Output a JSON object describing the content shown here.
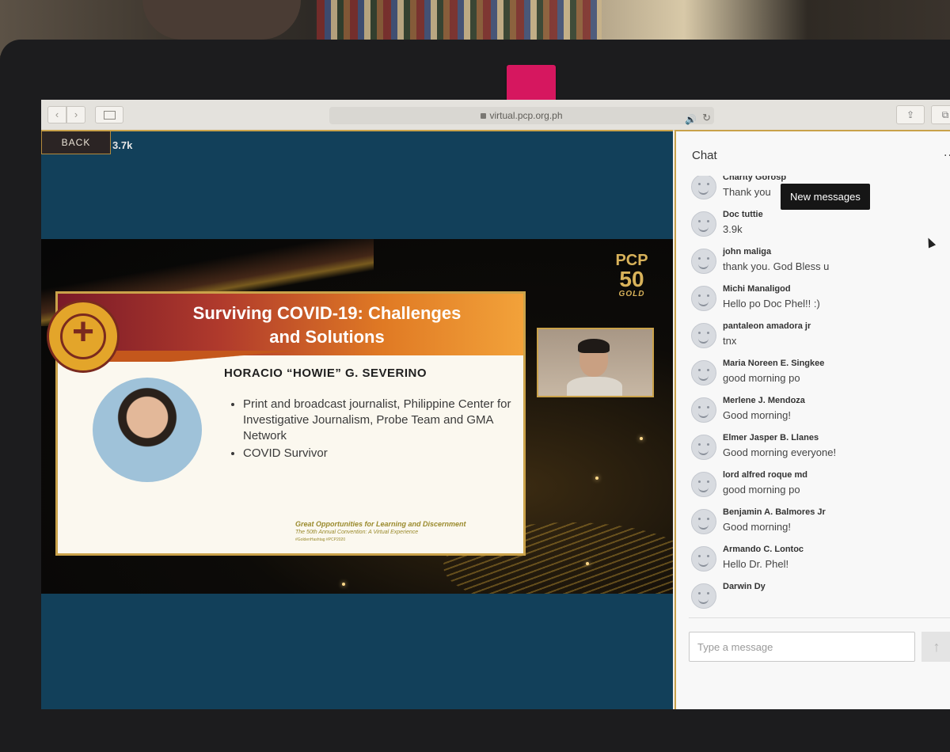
{
  "browser": {
    "url": "virtual.pcp.org.ph",
    "back_glyph": "‹",
    "forward_glyph": "›",
    "volume_glyph": "🔊",
    "reload_glyph": "↻",
    "share_glyph": "⇪",
    "tabs_glyph": "⧉"
  },
  "stage": {
    "back_label": "BACK",
    "viewer_count": "3.7k"
  },
  "slide": {
    "title": "Surviving COVID-19: Challenges and Solutions",
    "speaker_name": "HORACIO “HOWIE” G. SEVERINO",
    "bullets": [
      "Print and broadcast journalist, Philippine Center for Investigative Journalism, Probe Team and GMA Network",
      "COVID Survivor"
    ],
    "footer_line1": "Great Opportunities for Learning and Discernment",
    "footer_line2": "The 50th Annual Convention: A Virtual Experience",
    "footer_line3": "#GoldenHashtag #PCP2020"
  },
  "logo": {
    "line1": "PCP",
    "line2": "50",
    "line3": "GOLD"
  },
  "chat": {
    "title": "Chat",
    "more_glyph": "...",
    "new_messages_label": "New messages",
    "input_placeholder": "Type a message",
    "send_glyph": "↑",
    "messages": [
      {
        "name": "Charity Gorosp",
        "text": "Thank you"
      },
      {
        "name": "Doc tuttie",
        "text": "3.9k"
      },
      {
        "name": "john maliga",
        "text": "thank you. God Bless u"
      },
      {
        "name": "Michi Manaligod",
        "text": "Hello po Doc Phel!! :)"
      },
      {
        "name": "pantaleon amadora jr",
        "text": "tnx"
      },
      {
        "name": "Maria Noreen E. Singkee",
        "text": "good morning po"
      },
      {
        "name": "Merlene J. Mendoza",
        "text": "Good morning!"
      },
      {
        "name": "Elmer Jasper B. Llanes",
        "text": "Good morning everyone!"
      },
      {
        "name": "lord alfred roque md",
        "text": "good morning po"
      },
      {
        "name": "Benjamin A. Balmores Jr",
        "text": "Good morning!"
      },
      {
        "name": "Armando C. Lontoc",
        "text": "Hello Dr. Phel!"
      },
      {
        "name": "Darwin Dy",
        "text": ""
      }
    ]
  },
  "colors": {
    "accent_gold": "#c9a24a",
    "stage_blue": "#12405a",
    "tape_pink": "#d6175f"
  }
}
